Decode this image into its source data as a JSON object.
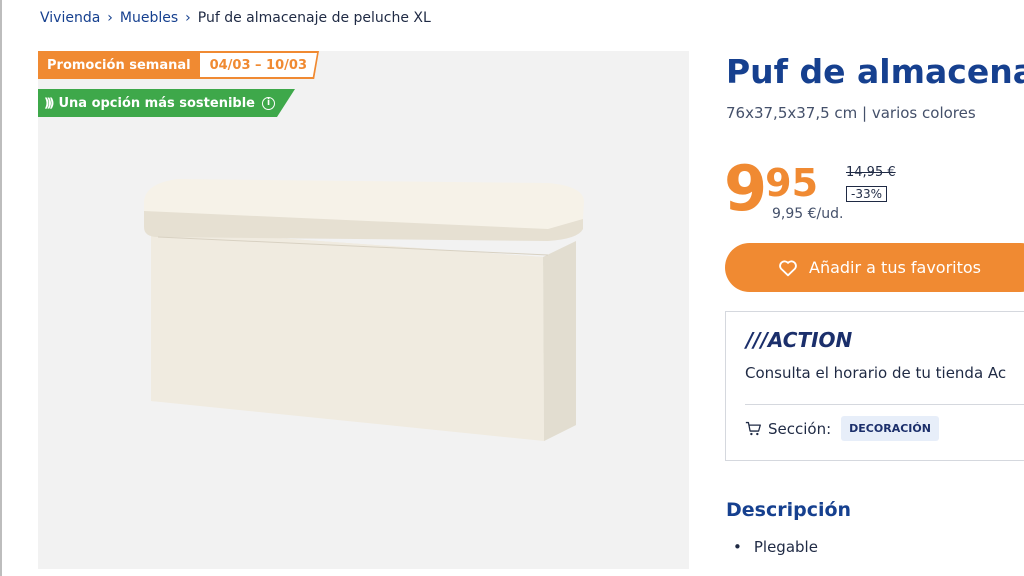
{
  "breadcrumb": {
    "items": [
      "Vivienda",
      "Muebles"
    ],
    "current": "Puf de almacenaje de peluche XL"
  },
  "badges": {
    "promo_label": "Promoción semanal",
    "promo_dates": "04/03 – 10/03",
    "eco_label": "Una opción más sostenible"
  },
  "product": {
    "title": "Puf de almacenaje",
    "subtitle": "76x37,5x37,5 cm | varios colores",
    "price_int": "9",
    "price_dec": "95",
    "unit_price": "9,95 €/ud.",
    "old_price": "14,95 €",
    "discount": "-33%"
  },
  "favorites_button": {
    "label": "Añadir a tus favoritos",
    "icon": "heart-icon"
  },
  "store": {
    "logo_text": "///ACTION",
    "schedule_text": "Consulta el horario de tu tienda Ac",
    "section_label": "Sección:",
    "section_value": "DECORACIÓN",
    "section_icon": "cart-icon"
  },
  "description": {
    "title": "Descripción",
    "items": [
      "Plegable"
    ]
  },
  "colors": {
    "brand_blue": "#16408f",
    "accent_orange": "#f08a32",
    "eco_green": "#3ea84a",
    "image_bg": "#f2f2f2"
  }
}
